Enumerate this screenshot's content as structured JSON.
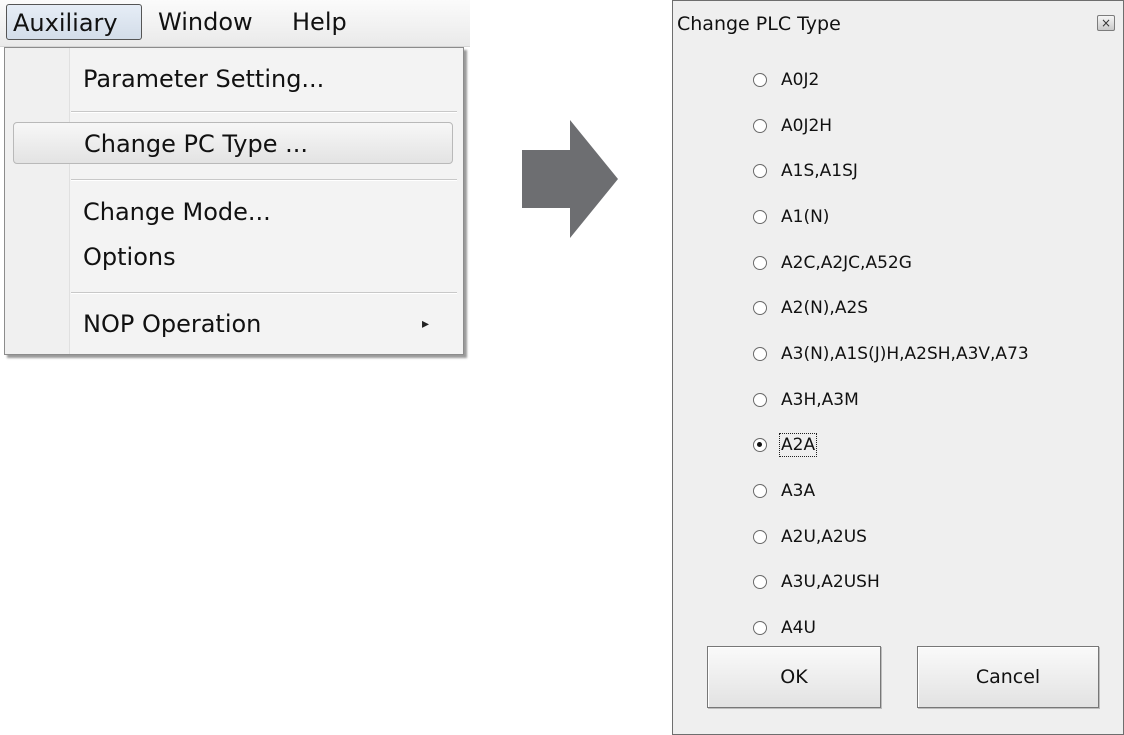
{
  "menubar": {
    "items": [
      "Auxiliary",
      "Window",
      "Help"
    ]
  },
  "menu": {
    "items": [
      "Parameter Setting...",
      "Change PC Type ...",
      "Change Mode...",
      "Options",
      "NOP Operation"
    ],
    "submenu_glyph": "▸"
  },
  "dialog": {
    "title": "Change PLC Type",
    "close_glyph": "×",
    "options": [
      "A0J2",
      "A0J2H",
      "A1S,A1SJ",
      "A1(N)",
      "A2C,A2JC,A52G",
      "A2(N),A2S",
      "A3(N),A1S(J)H,A2SH,A3V,A73",
      "A3H,A3M",
      "A2A",
      "A3A",
      "A2U,A2US",
      "A3U,A2USH",
      "A4U"
    ],
    "selected": "A2A",
    "ok_label": "OK",
    "cancel_label": "Cancel"
  },
  "colors": {
    "arrow": "#6d6e71",
    "menu_highlight": "#e3e3e3",
    "dialog_bg": "#efefef"
  }
}
